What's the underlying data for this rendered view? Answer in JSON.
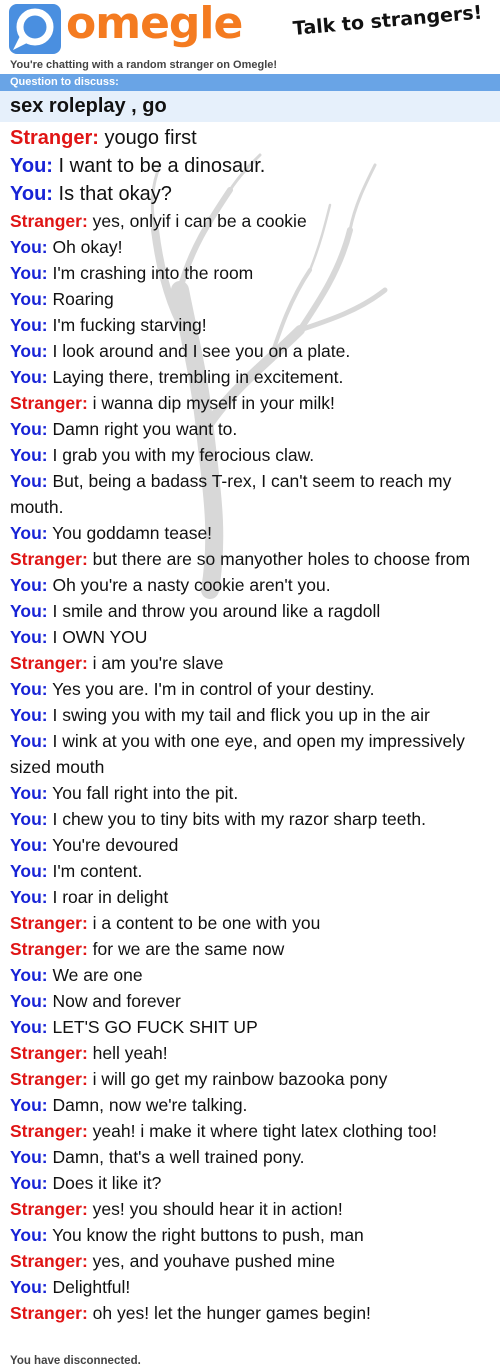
{
  "header": {
    "logo_text": "omegle",
    "tagline": "Talk to strangers!",
    "subline": "You're chatting with a random stranger on Omegle!"
  },
  "question": {
    "label": "Question to discuss:",
    "text": "sex roleplay , go"
  },
  "colors": {
    "stranger": "#e01515",
    "you": "#1723d6",
    "brand": "#f47b20",
    "question_bar": "#69a4e6"
  },
  "messages": [
    {
      "who": "Stranger:",
      "text": "yougo first",
      "big": true
    },
    {
      "who": "You:",
      "text": "I want to be a dinosaur.",
      "big": true
    },
    {
      "who": "You:",
      "text": "Is that okay?",
      "big": true
    },
    {
      "who": "Stranger:",
      "text": "yes, onlyif i can be a cookie"
    },
    {
      "who": "You:",
      "text": "Oh okay!"
    },
    {
      "who": "You:",
      "text": "I'm crashing into the room"
    },
    {
      "who": "You:",
      "text": "Roaring"
    },
    {
      "who": "You:",
      "text": "I'm fucking starving!"
    },
    {
      "who": "You:",
      "text": "I look around and I see you on a plate."
    },
    {
      "who": "You:",
      "text": "Laying there, trembling in excitement."
    },
    {
      "who": "Stranger:",
      "text": "i wanna dip myself in your milk!"
    },
    {
      "who": "You:",
      "text": "Damn right you want to."
    },
    {
      "who": "You:",
      "text": "I grab you with my ferocious claw."
    },
    {
      "who": "You:",
      "text": "But, being a badass T-rex, I can't seem to reach my mouth."
    },
    {
      "who": "You:",
      "text": "You goddamn tease!"
    },
    {
      "who": "Stranger:",
      "text": "but there are so manyother holes to choose from"
    },
    {
      "who": "You:",
      "text": "Oh you're a nasty cookie aren't you."
    },
    {
      "who": "You:",
      "text": "I smile and throw you around like a ragdoll"
    },
    {
      "who": "You:",
      "text": "I OWN YOU"
    },
    {
      "who": "Stranger:",
      "text": "i am you're slave"
    },
    {
      "who": "You:",
      "text": "Yes you are. I'm in control of your destiny."
    },
    {
      "who": "You:",
      "text": "I swing you with my tail and flick you up in the air"
    },
    {
      "who": "You:",
      "text": "I wink at you with one eye, and open my impressively sized mouth"
    },
    {
      "who": "You:",
      "text": "You fall right into the pit."
    },
    {
      "who": "You:",
      "text": "I chew you to tiny bits with my razor sharp teeth."
    },
    {
      "who": "You:",
      "text": "You're devoured"
    },
    {
      "who": "You:",
      "text": "I'm content."
    },
    {
      "who": "You:",
      "text": "I roar in delight"
    },
    {
      "who": "Stranger:",
      "text": "i a content to be one with you"
    },
    {
      "who": "Stranger:",
      "text": "for we are the same now"
    },
    {
      "who": "You:",
      "text": "We are one"
    },
    {
      "who": "You:",
      "text": "Now and forever"
    },
    {
      "who": "You:",
      "text": "LET'S GO FUCK SHIT UP"
    },
    {
      "who": "Stranger:",
      "text": "hell yeah!"
    },
    {
      "who": "Stranger:",
      "text": "i will go get my rainbow bazooka pony"
    },
    {
      "who": "You:",
      "text": "Damn, now we're talking."
    },
    {
      "who": "Stranger:",
      "text": "yeah! i make it where tight latex clothing too!"
    },
    {
      "who": "You:",
      "text": "Damn, that's a well trained pony."
    },
    {
      "who": "You:",
      "text": "Does it like it?"
    },
    {
      "who": "Stranger:",
      "text": "yes! you should hear it in action!"
    },
    {
      "who": "You:",
      "text": "You know the right buttons to push, man"
    },
    {
      "who": "Stranger:",
      "text": "yes, and youhave pushed mine"
    },
    {
      "who": "You:",
      "text": "Delightful!"
    },
    {
      "who": "Stranger:",
      "text": "oh yes! let the hunger games begin!"
    }
  ],
  "status": {
    "disconnected": "You have disconnected."
  }
}
